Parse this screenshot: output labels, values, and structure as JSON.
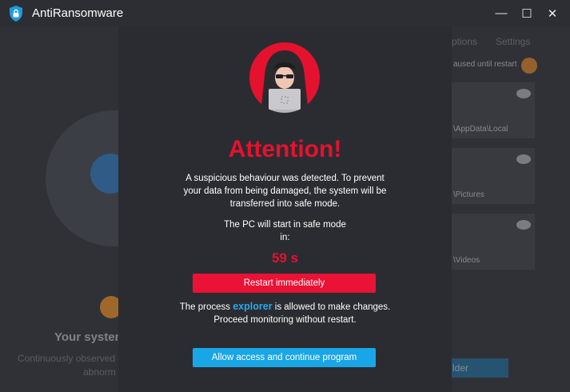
{
  "window": {
    "title": "AntiRansomware",
    "minimize_glyph": "—",
    "maximize_glyph": "☐",
    "close_glyph": "✕"
  },
  "background": {
    "tab_options": "ptions",
    "tab_settings": "Settings",
    "paused_text": "aused until restart",
    "path_1": "\\AppData\\Local",
    "path_2": "\\Pictures",
    "path_3": "\\Videos",
    "status_title": "Your system",
    "status_desc_1": "Continuously observed a",
    "status_desc_2": "abnorm",
    "folder_button": "lder"
  },
  "modal": {
    "title": "Attention!",
    "message": "A suspicious behaviour was detected. To prevent your data from being damaged, the system will be transferred into safe mode.",
    "safe_mode_line1": "The PC will start in safe mode",
    "safe_mode_line2": "in:",
    "countdown": "59 s",
    "restart_button": "Restart immediately",
    "process_prefix": "The process ",
    "process_name": "explorer",
    "process_suffix": " is allowed to make changes.",
    "process_line2": "Proceed monitoring without restart.",
    "allow_button": "Allow access and continue program"
  },
  "colors": {
    "accent_red": "#e4122e",
    "accent_blue": "#18a6e6",
    "pause_orange": "#a0672b",
    "background": "#2b2c31"
  },
  "icons": {
    "app": "shield-lock-icon",
    "hacker": "hooded-hacker-laptop-icon",
    "pause": "pause-icon",
    "eye": "eye-icon"
  }
}
